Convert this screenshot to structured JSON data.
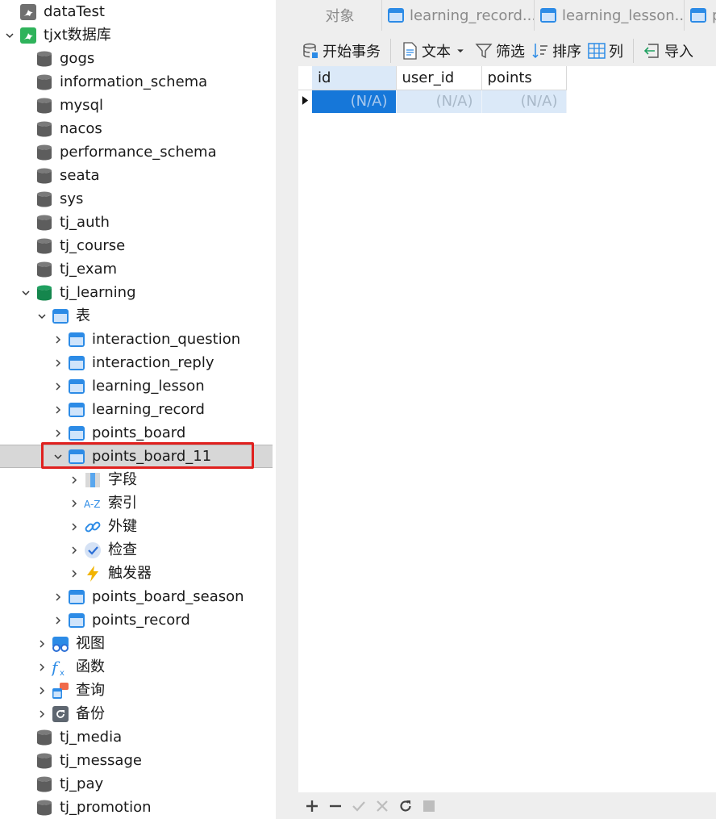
{
  "nav": {
    "connection_datatest": "dataTest",
    "connection_tjxt": "tjxt数据库",
    "databases_top": [
      "gogs",
      "information_schema",
      "mysql",
      "nacos",
      "performance_schema",
      "seata",
      "sys",
      "tj_auth",
      "tj_course",
      "tj_exam"
    ],
    "db_learning": "tj_learning",
    "folder_tables": "表",
    "tables": [
      "interaction_question",
      "interaction_reply",
      "learning_lesson",
      "learning_record",
      "points_board"
    ],
    "selected_table": "points_board_11",
    "table_children": [
      "字段",
      "索引",
      "外键",
      "检查",
      "触发器"
    ],
    "tables_after": [
      "points_board_season",
      "points_record"
    ],
    "folders_after": [
      "视图",
      "函数",
      "查询",
      "备份"
    ],
    "databases_bottom": [
      "tj_media",
      "tj_message",
      "tj_pay",
      "tj_promotion"
    ]
  },
  "tabs": [
    "对象",
    "learning_record...",
    "learning_lesson...",
    "p"
  ],
  "toolbar": {
    "begin_transaction": "开始事务",
    "text": "文本",
    "filter": "筛选",
    "sort": "排序",
    "columns": "列",
    "import": "导入"
  },
  "grid": {
    "columns": [
      "id",
      "user_id",
      "points"
    ],
    "rows": [
      [
        "(N/A)",
        "(N/A)",
        "(N/A)"
      ]
    ]
  },
  "colors": {
    "selection_outline": "#e0201e",
    "active_cell": "#1677d9",
    "db_active": "#1fa060",
    "db_inactive": "#6e6e6e"
  }
}
